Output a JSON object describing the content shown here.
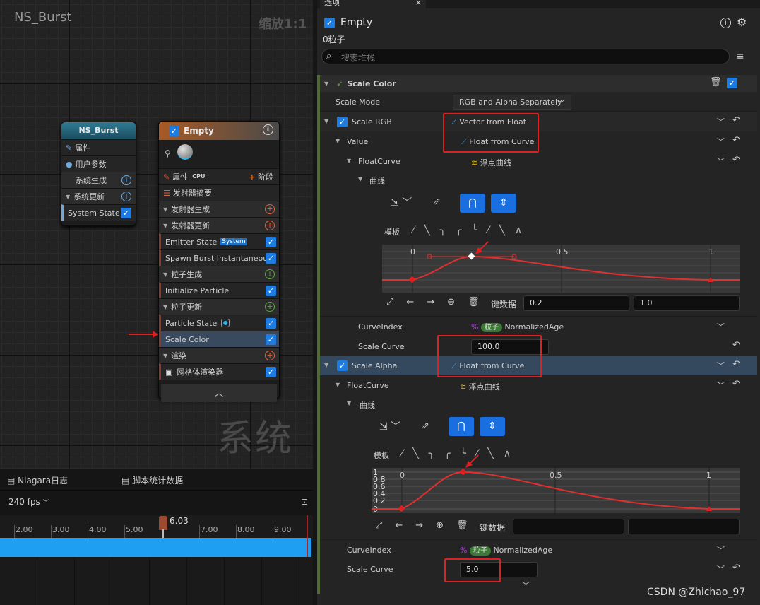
{
  "graph": {
    "title": "NS_Burst",
    "zoom": "缩放1:1",
    "watermark": "系统",
    "system_node": {
      "title": "NS_Burst",
      "rows": [
        "属性",
        "用户参数",
        "系统生成",
        "系统更新"
      ],
      "state": "System State"
    },
    "emitter_node": {
      "title": "Empty",
      "props": "属性",
      "cpu": "CPU",
      "stage": "阶段",
      "summary": "发射器摘要",
      "rows": [
        {
          "label": "发射器生成",
          "type": "sec"
        },
        {
          "label": "发射器更新",
          "type": "sec"
        },
        {
          "label": "Emitter State",
          "badge": "System",
          "type": "mod"
        },
        {
          "label": "Spawn Burst Instantaneous",
          "type": "mod"
        },
        {
          "label": "粒子生成",
          "type": "sec"
        },
        {
          "label": "Initialize Particle",
          "type": "mod"
        },
        {
          "label": "粒子更新",
          "type": "sec"
        },
        {
          "label": "Particle State",
          "type": "mod"
        },
        {
          "label": "Scale Color",
          "type": "sel"
        },
        {
          "label": "渲染",
          "type": "sec"
        },
        {
          "label": "网格体渲染器",
          "type": "mod"
        }
      ]
    }
  },
  "timeline": {
    "log_tab": "Niagara日志",
    "stats_tab": "脚本统计数据",
    "fps": "240 fps",
    "current": "6.03",
    "ticks": [
      "2.00",
      "3.00",
      "4.00",
      "5.00",
      "7.00",
      "8.00",
      "9.00"
    ]
  },
  "details": {
    "tab": "选项",
    "emitter": "Empty",
    "particles": "0粒子",
    "search_placeholder": "搜索堆栈",
    "module": "Scale Color",
    "scale_mode_label": "Scale Mode",
    "scale_mode": "RGB and Alpha Separately",
    "scale_rgb": "Scale RGB",
    "vector_from_float": "Vector from Float",
    "value": "Value",
    "float_from_curve": "Float from Curve",
    "float_curve": "FloatCurve",
    "float_curve_asset": "浮点曲线",
    "curve": "曲线",
    "template": "模板",
    "key_data": "键数据",
    "rgb_key_time": "0.2",
    "rgb_key_value": "1.0",
    "curve_index": "CurveIndex",
    "particles_pill": "粒子",
    "normalized_age": "NormalizedAge",
    "scale_curve": "Scale Curve",
    "rgb_scale_curve": "100.0",
    "scale_alpha": "Scale Alpha",
    "alpha_scale_curve": "5.0",
    "rgb_axis": [
      "0",
      "0.5",
      "1"
    ],
    "alpha_axis": [
      "0",
      "0.5",
      "1"
    ],
    "alpha_y_ticks": [
      "1",
      "0.8",
      "0.6",
      "0.4",
      "0.2",
      "0"
    ],
    "footer": "CSDN @Zhichao_97"
  }
}
